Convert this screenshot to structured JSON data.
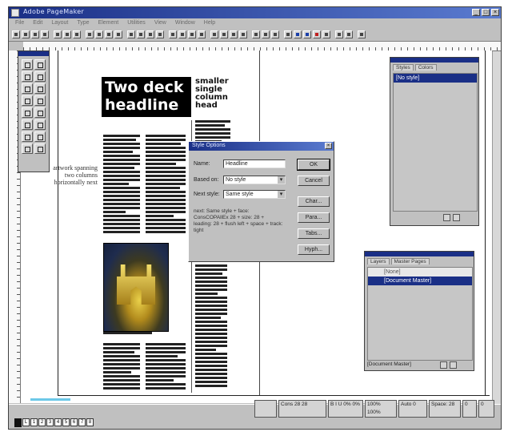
{
  "window": {
    "title": "Adobe PageMaker",
    "controls": [
      "_",
      "□",
      "×"
    ]
  },
  "menu": [
    "File",
    "Edit",
    "Layout",
    "Type",
    "Element",
    "Utilities",
    "View",
    "Window",
    "Help"
  ],
  "page": {
    "headline": "Two deck headline",
    "subhead": "smaller single column head",
    "pull_quote": "artwork spanning two columns horizontally next",
    "photo_alt": "photo"
  },
  "dialog": {
    "title": "Style Options",
    "fields": [
      {
        "label": "Name:",
        "value": "Headline"
      },
      {
        "label": "Based on:",
        "value": "No style"
      },
      {
        "label": "Next style:",
        "value": "Same style"
      }
    ],
    "note": "next: Same style + face: ConsCOPAllEx 28 + size: 28 + leading: 28 + flush left + space + track: tight",
    "buttons": [
      "OK",
      "Cancel",
      "Char...",
      "Para...",
      "Tabs...",
      "Hyph..."
    ]
  },
  "styles_palette": {
    "tabs": [
      "Styles",
      "Colors"
    ],
    "items": [
      {
        "label": "[No style]",
        "selected": true
      }
    ]
  },
  "master_palette": {
    "tabs": [
      "Layers",
      "Master Pages"
    ],
    "items": [
      {
        "label": "[None]",
        "selected": false
      },
      {
        "label": "[Document Master]",
        "selected": true
      }
    ],
    "footer": "[Document Master]"
  },
  "status": {
    "fields": [
      "Cons 28  28",
      "B I U  0%  0%",
      "100%  100%",
      "Auto  0",
      "Space: 28",
      "0",
      "0"
    ]
  }
}
